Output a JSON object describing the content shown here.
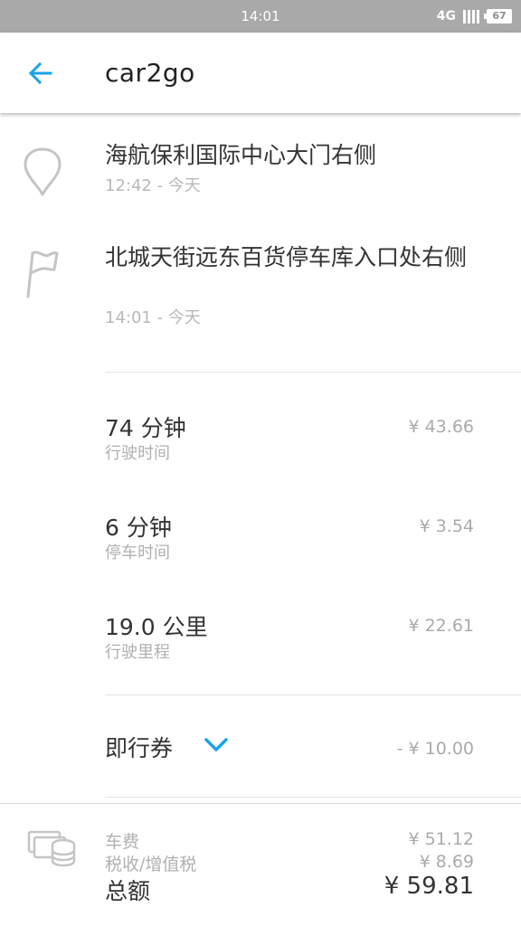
{
  "status_bar": {
    "time": "14:01",
    "network": "4G",
    "battery": "67"
  },
  "header": {
    "title": "car2go"
  },
  "trip": {
    "start": {
      "address": "海航保利国际中心大门右侧",
      "time": "12:42 - 今天"
    },
    "end": {
      "address": "北城天街远东百货停车库入口处右侧",
      "time": "14:01 - 今天"
    }
  },
  "fees": [
    {
      "value": "74 分钟",
      "label": "行驶时间",
      "price": "¥ 43.66"
    },
    {
      "value": "6 分钟",
      "label": "停车时间",
      "price": "¥ 3.54"
    },
    {
      "value": "19.0 公里",
      "label": "行驶里程",
      "price": "¥ 22.61"
    }
  ],
  "coupon": {
    "label": "即行券",
    "price": "- ¥ 10.00"
  },
  "summary": {
    "fare_label": "车费",
    "fare": "¥ 51.12",
    "tax_label": "税收/增值税",
    "tax": "¥ 8.69",
    "total_label": "总额",
    "total": "¥ 59.81"
  },
  "colors": {
    "accent": "#1aa3e8",
    "statusbar": "#a9a9a9",
    "muted_text": "#b0b0b0"
  },
  "icons": [
    "back-arrow-icon",
    "location-pin-icon",
    "flag-icon",
    "chevron-down-icon",
    "money-coins-icon",
    "signal-icon",
    "battery-icon"
  ]
}
